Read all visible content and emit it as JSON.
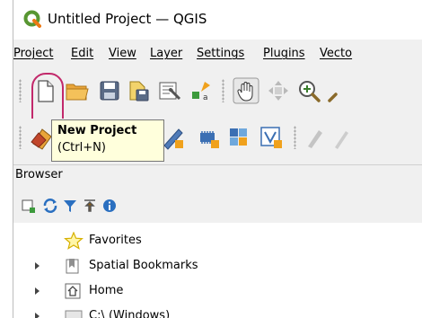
{
  "window": {
    "title": "Untitled Project — QGIS"
  },
  "menubar": {
    "items": [
      {
        "label": "Project"
      },
      {
        "label": "Edit"
      },
      {
        "label": "View"
      },
      {
        "label": "Layer"
      },
      {
        "label": "Settings"
      },
      {
        "label": "Plugins"
      },
      {
        "label": "Vecto"
      }
    ]
  },
  "toolbar1": {
    "buttons": [
      "new-project-icon",
      "open-project-icon",
      "save-project-icon",
      "save-as-icon",
      "print-layout-icon",
      "style-manager-icon",
      "pan-icon",
      "pan-to-selection-icon",
      "zoom-in-icon"
    ]
  },
  "tooltip": {
    "title": "New Project",
    "shortcut": "(Ctrl+N)"
  },
  "browser": {
    "title": "Browser",
    "toolbar": [
      "add-selected-icon",
      "refresh-icon",
      "filter-icon",
      "collapse-all-icon",
      "info-icon"
    ],
    "items": [
      {
        "label": "Favorites",
        "icon": "star-icon",
        "expandable": false
      },
      {
        "label": "Spatial Bookmarks",
        "icon": "bookmarks-icon",
        "expandable": true
      },
      {
        "label": "Home",
        "icon": "home-icon",
        "expandable": true
      },
      {
        "label": "C:\\ (Windows)",
        "icon": "drive-icon",
        "expandable": true
      }
    ]
  },
  "colors": {
    "highlight": "#c2296b",
    "tooltip_bg": "#ffffdc",
    "qgis_green": "#589632"
  }
}
